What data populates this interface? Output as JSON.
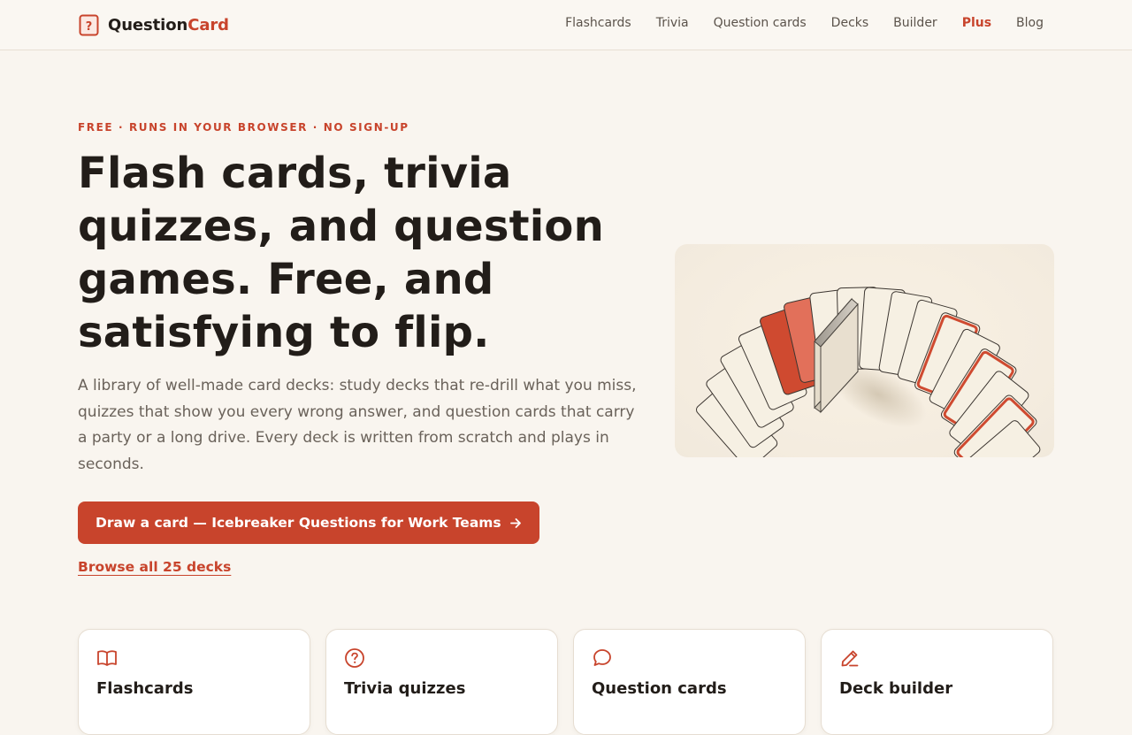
{
  "brand": {
    "name_part1": "Question",
    "name_part2": "Card",
    "icon": "question-card-icon"
  },
  "nav": {
    "links": [
      {
        "label": "Flashcards"
      },
      {
        "label": "Trivia"
      },
      {
        "label": "Question cards"
      },
      {
        "label": "Decks"
      },
      {
        "label": "Builder"
      },
      {
        "label": "Plus"
      },
      {
        "label": "Blog"
      }
    ]
  },
  "hero": {
    "eyebrow": "FREE · RUNS IN YOUR BROWSER · NO SIGN-UP",
    "title": "Flash cards, trivia quizzes, and question games. Free, and satisfying to flip.",
    "lead": "A library of well-made card decks: study decks that re-drill what you miss, quizzes that show you every wrong answer, and question cards that carry a party or a long drive. Every deck is written from scratch and plays in seconds.",
    "cta_label": "Draw a card — Icebreaker Questions for Work Teams",
    "browse_label": "Browse all 25 decks"
  },
  "features": [
    {
      "title": "Flashcards",
      "icon": "open-book-icon"
    },
    {
      "title": "Trivia quizzes",
      "icon": "question-circle-icon"
    },
    {
      "title": "Question cards",
      "icon": "speech-bubble-icon"
    },
    {
      "title": "Deck builder",
      "icon": "pencil-icon"
    }
  ],
  "colors": {
    "accent": "#c8442c",
    "background": "#f9f5ef",
    "text": "#221d19",
    "muted": "#6a625a"
  }
}
